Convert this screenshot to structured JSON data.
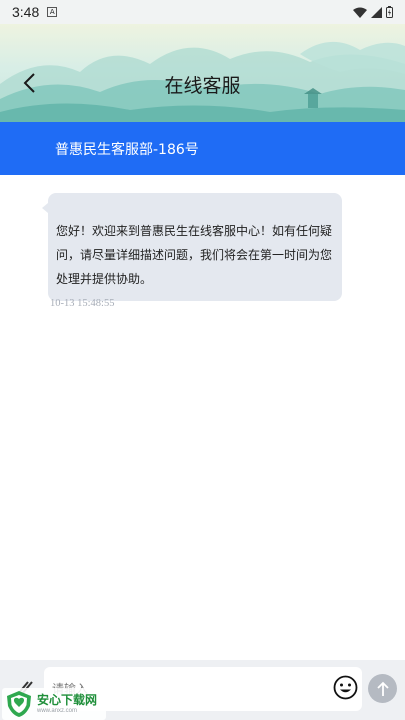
{
  "status_bar": {
    "time": "3:48",
    "notification_badge": "A"
  },
  "header": {
    "title": "在线客服",
    "back_icon": "chevron-left-icon"
  },
  "agent": {
    "name": "普惠民生客服部-186号"
  },
  "messages": [
    {
      "text": "您好！欢迎来到普惠民生在线客服中心！如有任何疑问，请尽量详细描述问题，我们将会在第一时间为您处理并提供协助。",
      "time": "10-13 15:48:55"
    }
  ],
  "composer": {
    "placeholder": "请输入",
    "emoji_icon": "smiley-icon",
    "send_icon": "arrow-up-icon"
  },
  "watermark": {
    "title": "安心下载网",
    "url": "www.anxz.com",
    "badge": "安全 无毒"
  },
  "colors": {
    "agent_bar": "#1f6cf5",
    "bubble": "#e4e8ef",
    "send_disabled": "#b5bac2"
  }
}
